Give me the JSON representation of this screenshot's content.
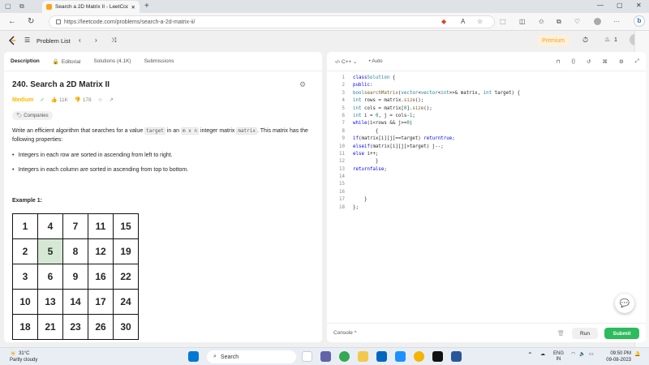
{
  "browser": {
    "tab_title": "Search a 2D Matrix II - LeetCode",
    "url": "https://leetcode.com/problems/search-a-2d-matrix-ii/"
  },
  "header": {
    "problem_list": "Problem List",
    "premium": "Premium",
    "streak_count": "1"
  },
  "left": {
    "tabs": [
      "Description",
      "Editorial",
      "Solutions (4.1K)",
      "Submissions"
    ],
    "title": "240. Search a 2D Matrix II",
    "difficulty": "Medium",
    "likes": "11K",
    "dislikes": "178",
    "companies": "Companies",
    "desc_1": "Write an efficient algorithm that searches for a value",
    "desc_code_1": "target",
    "desc_2": "in an",
    "desc_code_2": "m x n",
    "desc_3": "integer matrix",
    "desc_code_3": "matrix",
    "desc_4": ". This matrix has the following properties:",
    "bullet_1": "Integers in each row are sorted in ascending from left to right.",
    "bullet_2": "Integers in each column are sorted in ascending from top to bottom.",
    "example_label": "Example 1:",
    "matrix": [
      [
        "1",
        "4",
        "7",
        "11",
        "15"
      ],
      [
        "2",
        "5",
        "8",
        "12",
        "19"
      ],
      [
        "3",
        "6",
        "9",
        "16",
        "22"
      ],
      [
        "10",
        "13",
        "14",
        "17",
        "24"
      ],
      [
        "18",
        "21",
        "23",
        "26",
        "30"
      ]
    ]
  },
  "right": {
    "language": "C++",
    "auto": "Auto",
    "console": "Console",
    "run": "Run",
    "submit": "Submit"
  },
  "taskbar": {
    "temp": "31°C",
    "weather": "Partly cloudy",
    "search": "Search",
    "lang1": "ENG",
    "lang2": "IN",
    "time": "09:50 PM",
    "date": "09-08-2023"
  }
}
